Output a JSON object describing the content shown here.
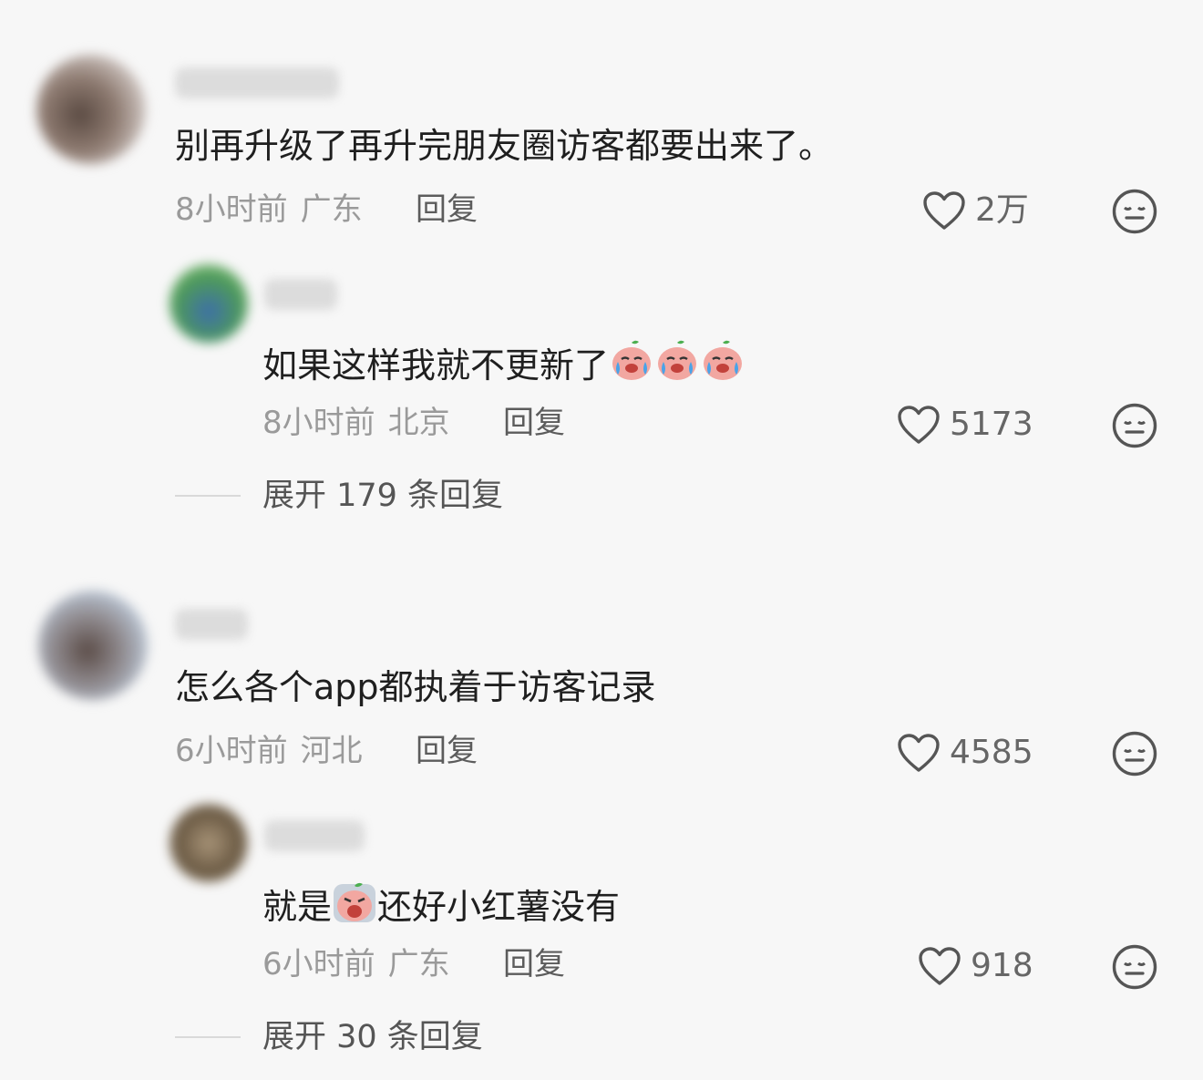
{
  "comments": [
    {
      "text": "别再升级了再升完朋友圈访客都要出来了。",
      "time": "8小时前",
      "location": "广东",
      "reply_label": "回复",
      "likes": "2万",
      "sub": {
        "text": "如果这样我就不更新了",
        "emoji_count": 3,
        "time": "8小时前",
        "location": "北京",
        "reply_label": "回复",
        "likes": "5173"
      },
      "expand_label": "展开 179 条回复"
    },
    {
      "text": "怎么各个app都执着于访客记录",
      "time": "6小时前",
      "location": "河北",
      "reply_label": "回复",
      "likes": "4585",
      "sub": {
        "text_before": "就是",
        "text_after": "还好小红薯没有",
        "time": "6小时前",
        "location": "广东",
        "reply_label": "回复",
        "likes": "918"
      },
      "expand_label": "展开 30 条回复"
    }
  ],
  "icons": {
    "like": "heart-outline-icon",
    "dislike": "neutral-face-icon",
    "emoji_cry": "crying-potato-emoji",
    "emoji_wail": "wailing-potato-emoji"
  },
  "colors": {
    "background": "#f7f7f7",
    "text": "#1f1f1f",
    "meta": "#9a9a9a",
    "reply": "#5c5c5c"
  }
}
